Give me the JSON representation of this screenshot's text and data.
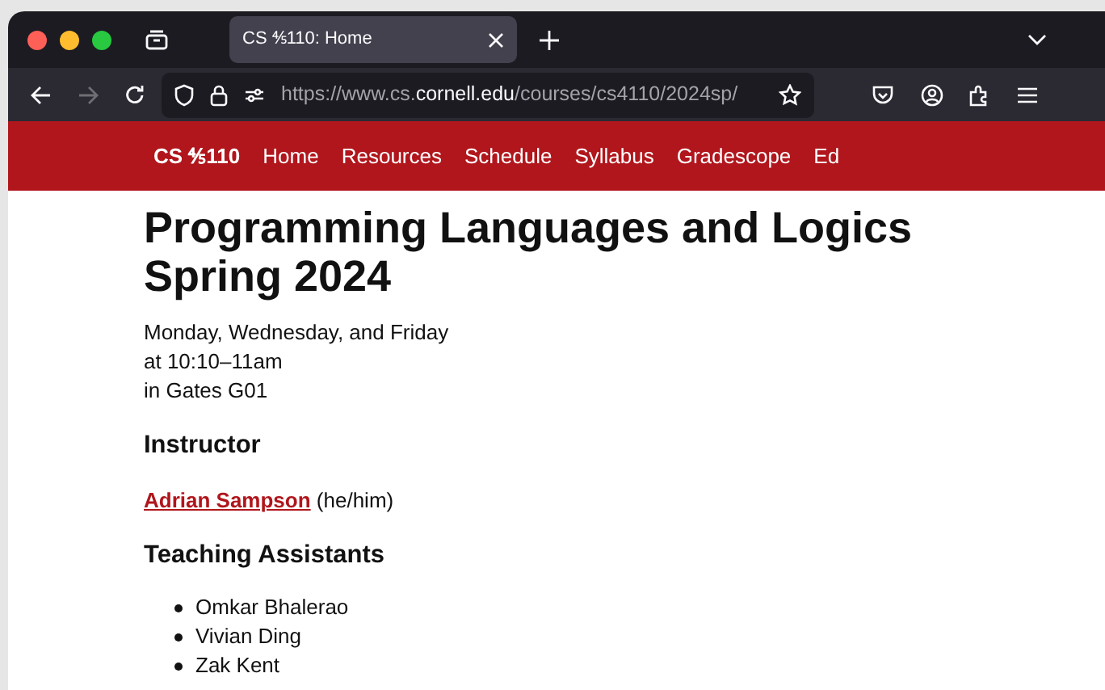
{
  "browser": {
    "tab": {
      "title": "CS ⅘110: Home",
      "selected": true
    },
    "url": {
      "prefix": "https://www.cs.",
      "domain": "cornell.edu",
      "path": "/courses/cs4110/2024sp/"
    },
    "forward_disabled": true
  },
  "navbar": {
    "brand": "CS ⅘110",
    "links": [
      "Home",
      "Resources",
      "Schedule",
      "Syllabus",
      "Gradescope",
      "Ed"
    ]
  },
  "page": {
    "title_lines": [
      "Programming Languages and Logics",
      "Spring 2024"
    ],
    "schedule_lines": [
      "Monday, Wednesday, and Friday",
      "at 10:10–11am",
      "in Gates G01"
    ],
    "instructor_heading": "Instructor",
    "instructor": {
      "name": "Adrian Sampson",
      "pronouns": "(he/him)"
    },
    "ta_heading": "Teaching Assistants",
    "tas": [
      "Omkar Bhalerao",
      "Vivian Ding",
      "Zak Kent"
    ]
  }
}
